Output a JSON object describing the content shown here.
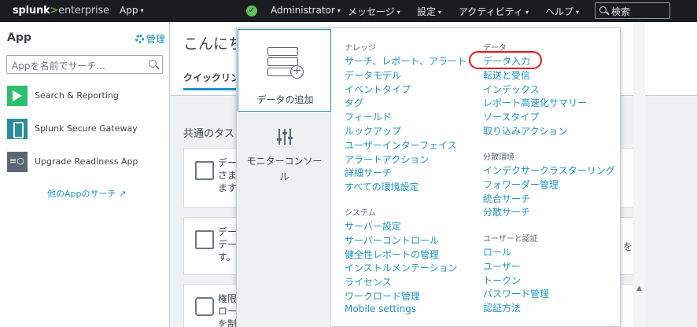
{
  "topbar": {
    "logo_splunk": "splunk",
    "logo_arrow": ">",
    "logo_enterprise": "enterprise",
    "app_menu": "App",
    "health_check": "✓",
    "user": "Administrator",
    "messages": "メッセージ",
    "settings": "設定",
    "activity": "アクティビティ",
    "help": "ヘルプ",
    "search_label": "検索",
    "caret": "▾"
  },
  "sidebar": {
    "title": "App",
    "manage": "管理",
    "search_placeholder": "Appを名前でサーチ...",
    "apps": [
      {
        "label": "Search & Reporting",
        "icon": "search-reporting-icon"
      },
      {
        "label": "Splunk Secure Gateway",
        "icon": "secure-gateway-icon"
      },
      {
        "label": "Upgrade Readiness App",
        "icon": "upgrade-readiness-icon"
      }
    ],
    "more_apps": "他のAppのサーチ"
  },
  "main": {
    "greeting": "こんにち",
    "quick_links_tab": "クイックリン",
    "common_tasks": "共通のタス",
    "cards": [
      {
        "line1": "デー",
        "line2": "さま",
        "line3": "ます"
      },
      {
        "line1": "デー",
        "line2": "デー",
        "line3": "す。",
        "trail": "を"
      },
      {
        "line1": "権限",
        "line2": "ロー",
        "line3": "を制"
      }
    ]
  },
  "dropdown": {
    "add_data": "データの追加",
    "monitoring_console_1": "モニターコンソー",
    "monitoring_console_2": "ル",
    "knowledge": {
      "heading": "ナレッジ",
      "items": [
        "サーチ、レポート、アラート",
        "データモデル",
        "イベントタイプ",
        "タグ",
        "フィールド",
        "ルックアップ",
        "ユーザーインターフェイス",
        "アラートアクション",
        "詳細サーチ",
        "すべての環境設定"
      ]
    },
    "system": {
      "heading": "システム",
      "items": [
        "サーバー設定",
        "サーバーコントロール",
        "健全性レポートの管理",
        "インストルメンテーション",
        "ライセンス",
        "ワークロード管理",
        "Mobile settings"
      ]
    },
    "data": {
      "heading": "データ",
      "items": [
        "データ入力",
        "転送と受信",
        "インデックス",
        "レポート高速化サマリー",
        "ソースタイプ",
        "取り込みアクション"
      ]
    },
    "distributed": {
      "heading": "分散環境",
      "items": [
        "インデクサークラスターリング",
        "フォワーダー管理",
        "統合サーチ",
        "分散サーチ"
      ]
    },
    "users_auth": {
      "heading": "ユーザーと認証",
      "items": [
        "ロール",
        "ユーザー",
        "トークン",
        "パスワード管理",
        "認証方法"
      ]
    },
    "highlight_color": "#e8181d",
    "accent_color": "#1e93c6"
  }
}
